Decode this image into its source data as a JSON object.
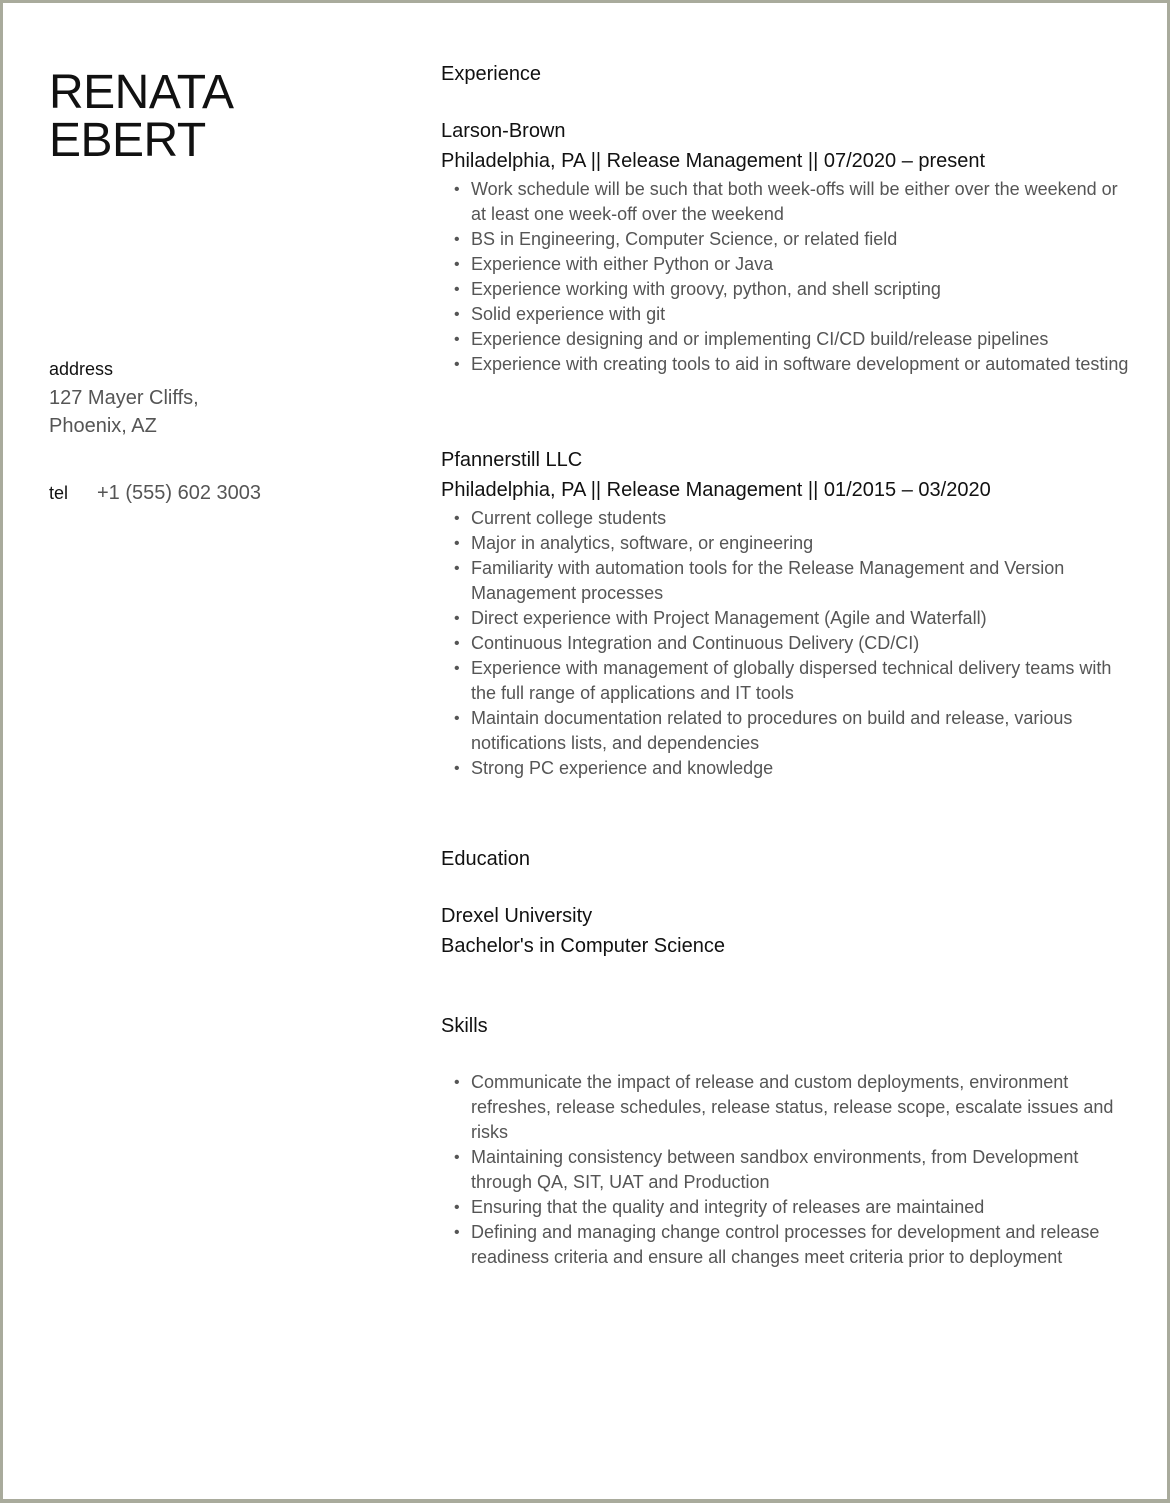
{
  "profile": {
    "first_name": "RENATA",
    "last_name": "EBERT",
    "address_label": "address",
    "address_line1": "127 Mayer Cliffs,",
    "address_line2": "Phoenix, AZ",
    "tel_label": "tel",
    "tel_value": "+1 (555) 602 3003"
  },
  "experience": {
    "title": "Experience",
    "jobs": [
      {
        "company": "Larson-Brown",
        "details": "Philadelphia, PA || Release Management || 07/2020 – present",
        "bullets": [
          "Work schedule will be such that both week-offs will be either over the weekend or at least one week-off over the weekend",
          "BS in Engineering, Computer Science, or related field",
          "Experience with either Python or Java",
          "Experience working with groovy, python, and shell scripting",
          "Solid experience with git",
          "Experience designing and or implementing CI/CD build/release pipelines",
          "Experience with creating tools to aid in software development or automated testing"
        ]
      },
      {
        "company": "Pfannerstill LLC",
        "details": "Philadelphia, PA || Release Management || 01/2015 – 03/2020",
        "bullets": [
          "Current college students",
          "Major in analytics, software, or engineering",
          "Familiarity with automation tools for the Release Management and Version Management processes",
          "Direct experience with Project Management (Agile and Waterfall)",
          "Continuous Integration and Continuous Delivery (CD/CI)",
          "Experience with management of globally dispersed technical delivery teams with the full range of applications and IT tools",
          "Maintain documentation related to procedures on build and release, various notifications lists, and dependencies",
          "Strong PC experience and knowledge"
        ]
      }
    ]
  },
  "education": {
    "title": "Education",
    "school": "Drexel University",
    "degree": "Bachelor's in Computer Science"
  },
  "skills": {
    "title": "Skills",
    "bullets": [
      "Communicate the impact of release and custom deployments, environment refreshes, release schedules, release status, release scope, escalate issues and risks",
      "Maintaining consistency between sandbox environments, from Development through QA, SIT, UAT and Production",
      "Ensuring that the quality and integrity of releases are maintained",
      "Defining and managing change control processes for development and release readiness criteria and ensure all changes meet criteria prior to deployment"
    ]
  }
}
